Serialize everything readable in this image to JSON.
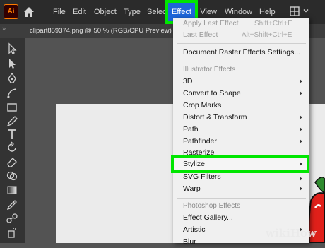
{
  "app": {
    "logo_text": "Ai"
  },
  "menubar": {
    "items": [
      {
        "label": "File"
      },
      {
        "label": "Edit"
      },
      {
        "label": "Object"
      },
      {
        "label": "Type"
      },
      {
        "label": "Select"
      },
      {
        "label": "Effect"
      },
      {
        "label": "View"
      },
      {
        "label": "Window"
      },
      {
        "label": "Help"
      }
    ]
  },
  "document_tab": {
    "label": "clipart859374.png @ 50 % (RGB/CPU Preview)"
  },
  "effect_menu": {
    "apply_last": {
      "label": "Apply Last Effect",
      "shortcut": "Shift+Ctrl+E"
    },
    "last": {
      "label": "Last Effect",
      "shortcut": "Alt+Shift+Ctrl+E"
    },
    "doc_raster": {
      "label": "Document Raster Effects Settings..."
    },
    "illustrator_header": "Illustrator Effects",
    "illustrator_items": [
      {
        "label": "3D",
        "submenu": true
      },
      {
        "label": "Convert to Shape",
        "submenu": true
      },
      {
        "label": "Crop Marks",
        "submenu": false
      },
      {
        "label": "Distort & Transform",
        "submenu": true
      },
      {
        "label": "Path",
        "submenu": true
      },
      {
        "label": "Pathfinder",
        "submenu": true
      },
      {
        "label": "Rasterize",
        "submenu": false
      },
      {
        "label": "Stylize",
        "submenu": true
      },
      {
        "label": "SVG Filters",
        "submenu": true
      },
      {
        "label": "Warp",
        "submenu": true
      }
    ],
    "photoshop_header": "Photoshop Effects",
    "photoshop_items": [
      {
        "label": "Effect Gallery...",
        "submenu": false
      },
      {
        "label": "Artistic",
        "submenu": true
      },
      {
        "label": "Blur",
        "submenu": true
      }
    ]
  },
  "watermark": {
    "text": "wikiHow"
  },
  "colors": {
    "highlight": "#00e600",
    "active_menu": "#1e66d9",
    "logo": "#ff7c00"
  }
}
